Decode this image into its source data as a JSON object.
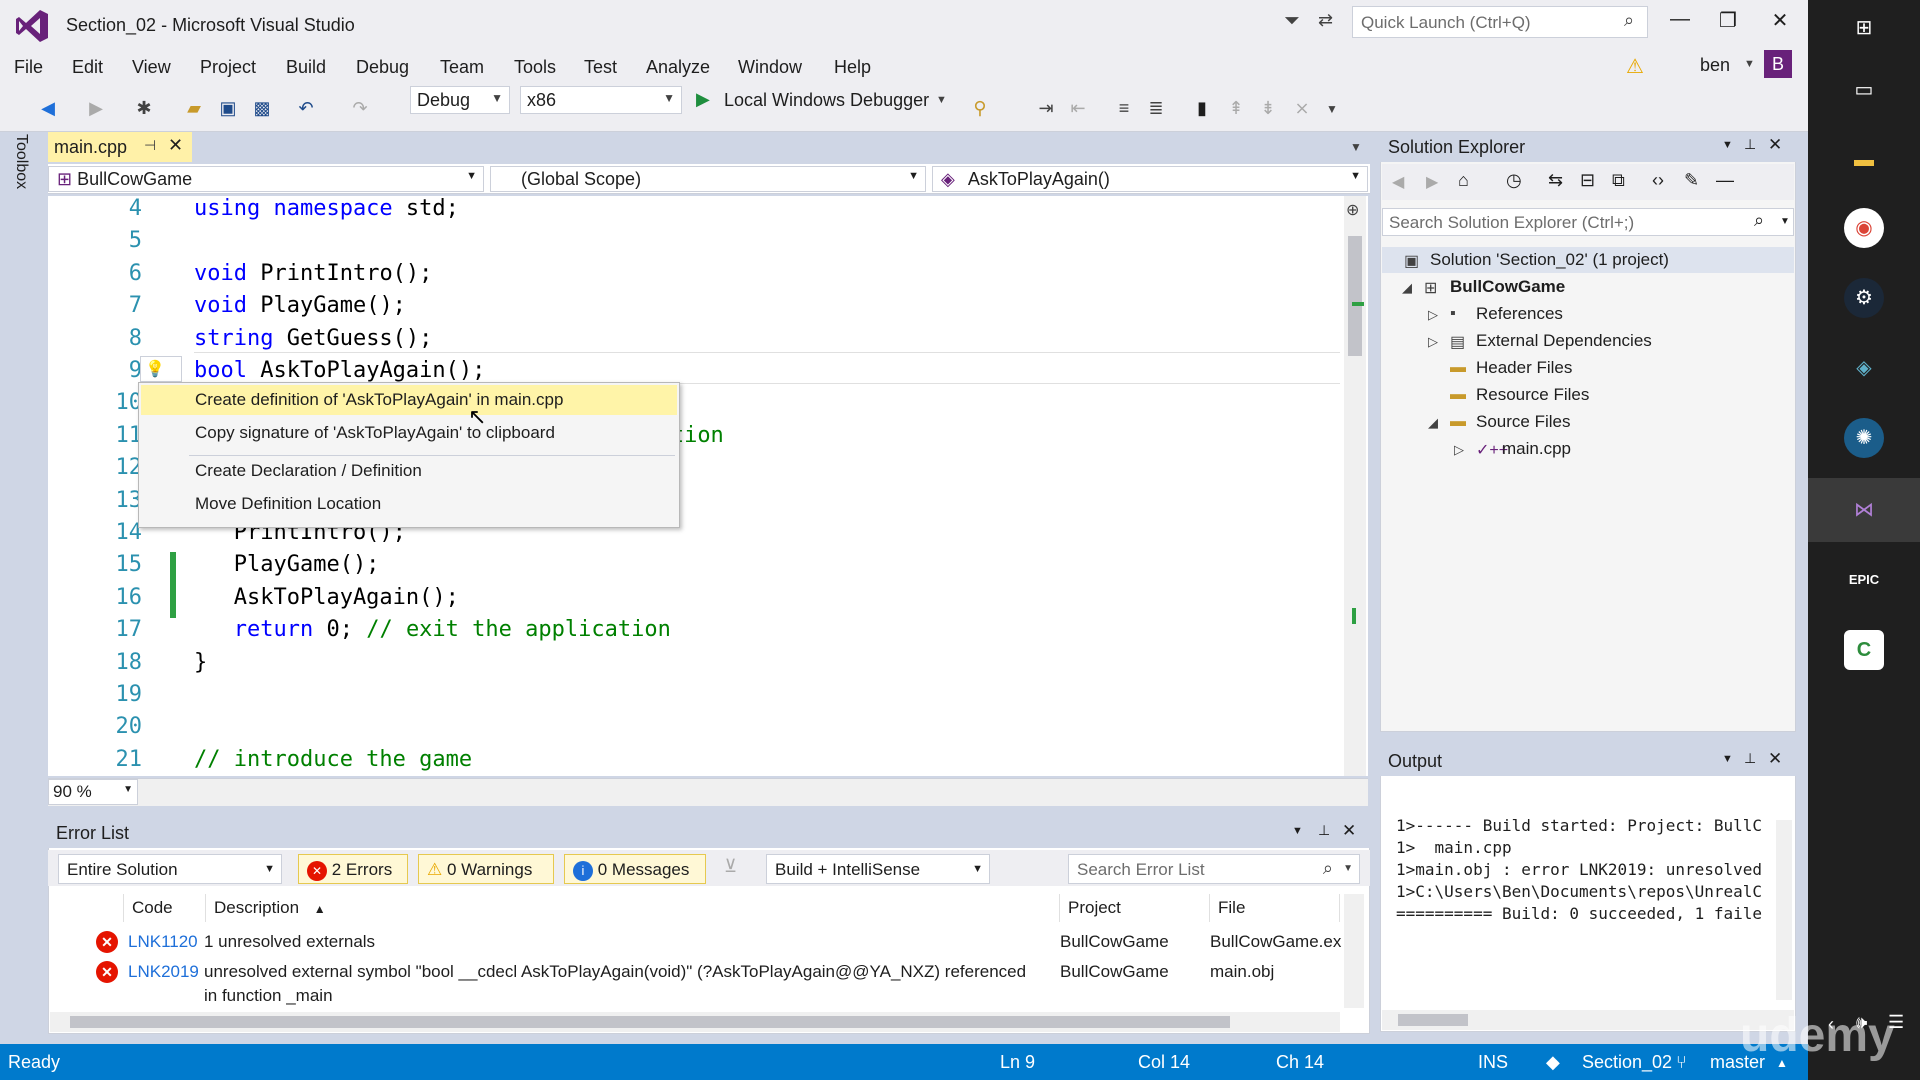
{
  "window": {
    "title": "Section_02 - Microsoft Visual Studio",
    "quick_launch_placeholder": "Quick Launch (Ctrl+Q)",
    "user": "ben",
    "user_initial": "B",
    "minimize": "—",
    "restore": "❐",
    "close": "✕"
  },
  "menu": [
    "File",
    "Edit",
    "View",
    "Project",
    "Build",
    "Debug",
    "Team",
    "Tools",
    "Test",
    "Analyze",
    "Window",
    "Help"
  ],
  "toolbar": {
    "config": "Debug",
    "platform": "x86",
    "debugger": "Local Windows Debugger",
    "icons": [
      "back-icon",
      "forward-icon",
      "new-project-icon",
      "open-icon",
      "save-icon",
      "save-all-icon",
      "undo-icon",
      "redo-icon"
    ]
  },
  "toolbox_label": "Toolbox",
  "editor": {
    "tab": "main.cpp",
    "project_combo": "BullCowGame",
    "scope_combo": "(Global Scope)",
    "member_combo": "AskToPlayAgain()",
    "zoom": "90 %",
    "lines": [
      {
        "n": "4",
        "parts": [
          {
            "t": "using namespace ",
            "c": "kw"
          },
          {
            "t": "std;",
            "c": "fn"
          }
        ]
      },
      {
        "n": "5",
        "parts": []
      },
      {
        "n": "6",
        "parts": [
          {
            "t": "void ",
            "c": "kw"
          },
          {
            "t": "PrintIntro();",
            "c": "fn"
          }
        ]
      },
      {
        "n": "7",
        "parts": [
          {
            "t": "void ",
            "c": "kw"
          },
          {
            "t": "PlayGame();",
            "c": "fn"
          }
        ]
      },
      {
        "n": "8",
        "parts": [
          {
            "t": "string ",
            "c": "kw"
          },
          {
            "t": "GetGuess();",
            "c": "fn"
          }
        ]
      },
      {
        "n": "9",
        "parts": [
          {
            "t": "bool ",
            "c": "kw"
          },
          {
            "t": "AskToPlayAgain();",
            "c": "fn"
          }
        ]
      },
      {
        "n": "10",
        "parts": []
      },
      {
        "n": "11",
        "parts": [
          {
            "t": "                                    tion",
            "c": "cm"
          }
        ]
      },
      {
        "n": "12",
        "parts": []
      },
      {
        "n": "13",
        "parts": []
      },
      {
        "n": "14",
        "parts": [
          {
            "t": "   PrintIntro();",
            "c": "fn"
          }
        ]
      },
      {
        "n": "15",
        "parts": [
          {
            "t": "   PlayGame();",
            "c": "fn"
          }
        ]
      },
      {
        "n": "16",
        "parts": [
          {
            "t": "   AskToPlayAgain();",
            "c": "fn"
          }
        ]
      },
      {
        "n": "17",
        "parts": [
          {
            "t": "   return ",
            "c": "kw"
          },
          {
            "t": "0; ",
            "c": "fn"
          },
          {
            "t": "// exit the application",
            "c": "cm"
          }
        ]
      },
      {
        "n": "18",
        "parts": [
          {
            "t": "}",
            "c": "fn"
          }
        ]
      },
      {
        "n": "19",
        "parts": []
      },
      {
        "n": "20",
        "parts": []
      },
      {
        "n": "21",
        "parts": [
          {
            "t": "// introduce the game",
            "c": "cm"
          }
        ]
      }
    ]
  },
  "quick_actions": [
    "Create definition of 'AskToPlayAgain' in main.cpp",
    "Copy signature of 'AskToPlayAgain' to clipboard",
    "Create Declaration / Definition",
    "Move Definition Location"
  ],
  "solution_explorer": {
    "title": "Solution Explorer",
    "search_placeholder": "Search Solution Explorer (Ctrl+;)",
    "items": [
      {
        "label": "Solution 'Section_02' (1 project)",
        "arrow": "",
        "icon": "▣"
      },
      {
        "label": "BullCowGame",
        "arrow": "◢",
        "icon": "⊞"
      },
      {
        "label": "References",
        "arrow": "▷",
        "icon": "▪"
      },
      {
        "label": "External Dependencies",
        "arrow": "▷",
        "icon": "▤"
      },
      {
        "label": "Header Files",
        "arrow": "",
        "icon": "▬"
      },
      {
        "label": "Resource Files",
        "arrow": "",
        "icon": "▬"
      },
      {
        "label": "Source Files",
        "arrow": "◢",
        "icon": "▬"
      },
      {
        "label": "main.cpp",
        "arrow": "▷",
        "icon": "✓++"
      }
    ]
  },
  "output": {
    "title": "Output",
    "lines": [
      "1>------ Build started: Project: BullC",
      "1>  main.cpp",
      "1>main.obj : error LNK2019: unresolved",
      "1>C:\\Users\\Ben\\Documents\\repos\\UnrealC",
      "========== Build: 0 succeeded, 1 faile"
    ]
  },
  "error_list": {
    "title": "Error List",
    "scope": "Entire Solution",
    "errors_btn": "2 Errors",
    "warnings_btn": "0 Warnings",
    "messages_btn": "0 Messages",
    "build_filter": "Build + IntelliSense",
    "search_placeholder": "Search Error List",
    "columns": [
      "Code",
      "Description",
      "Project",
      "File"
    ],
    "rows": [
      {
        "code": "LNK1120",
        "desc": "1 unresolved externals",
        "desc2": "",
        "project": "BullCowGame",
        "file": "BullCowGame.ex"
      },
      {
        "code": "LNK2019",
        "desc": "unresolved external symbol \"bool __cdecl AskToPlayAgain(void)\" (?AskToPlayAgain@@YA_NXZ) referenced",
        "desc2": "in function _main",
        "project": "BullCowGame",
        "file": "main.obj"
      }
    ]
  },
  "status": {
    "state": "Ready",
    "ln": "Ln 9",
    "col": "Col 14",
    "ch": "Ch 14",
    "mode": "INS",
    "repo": "Section_02",
    "branch": "master"
  },
  "watermark": "udemy",
  "colors": {
    "accent": "#007acc",
    "vs_purple": "#68217a",
    "error": "#e51400"
  }
}
